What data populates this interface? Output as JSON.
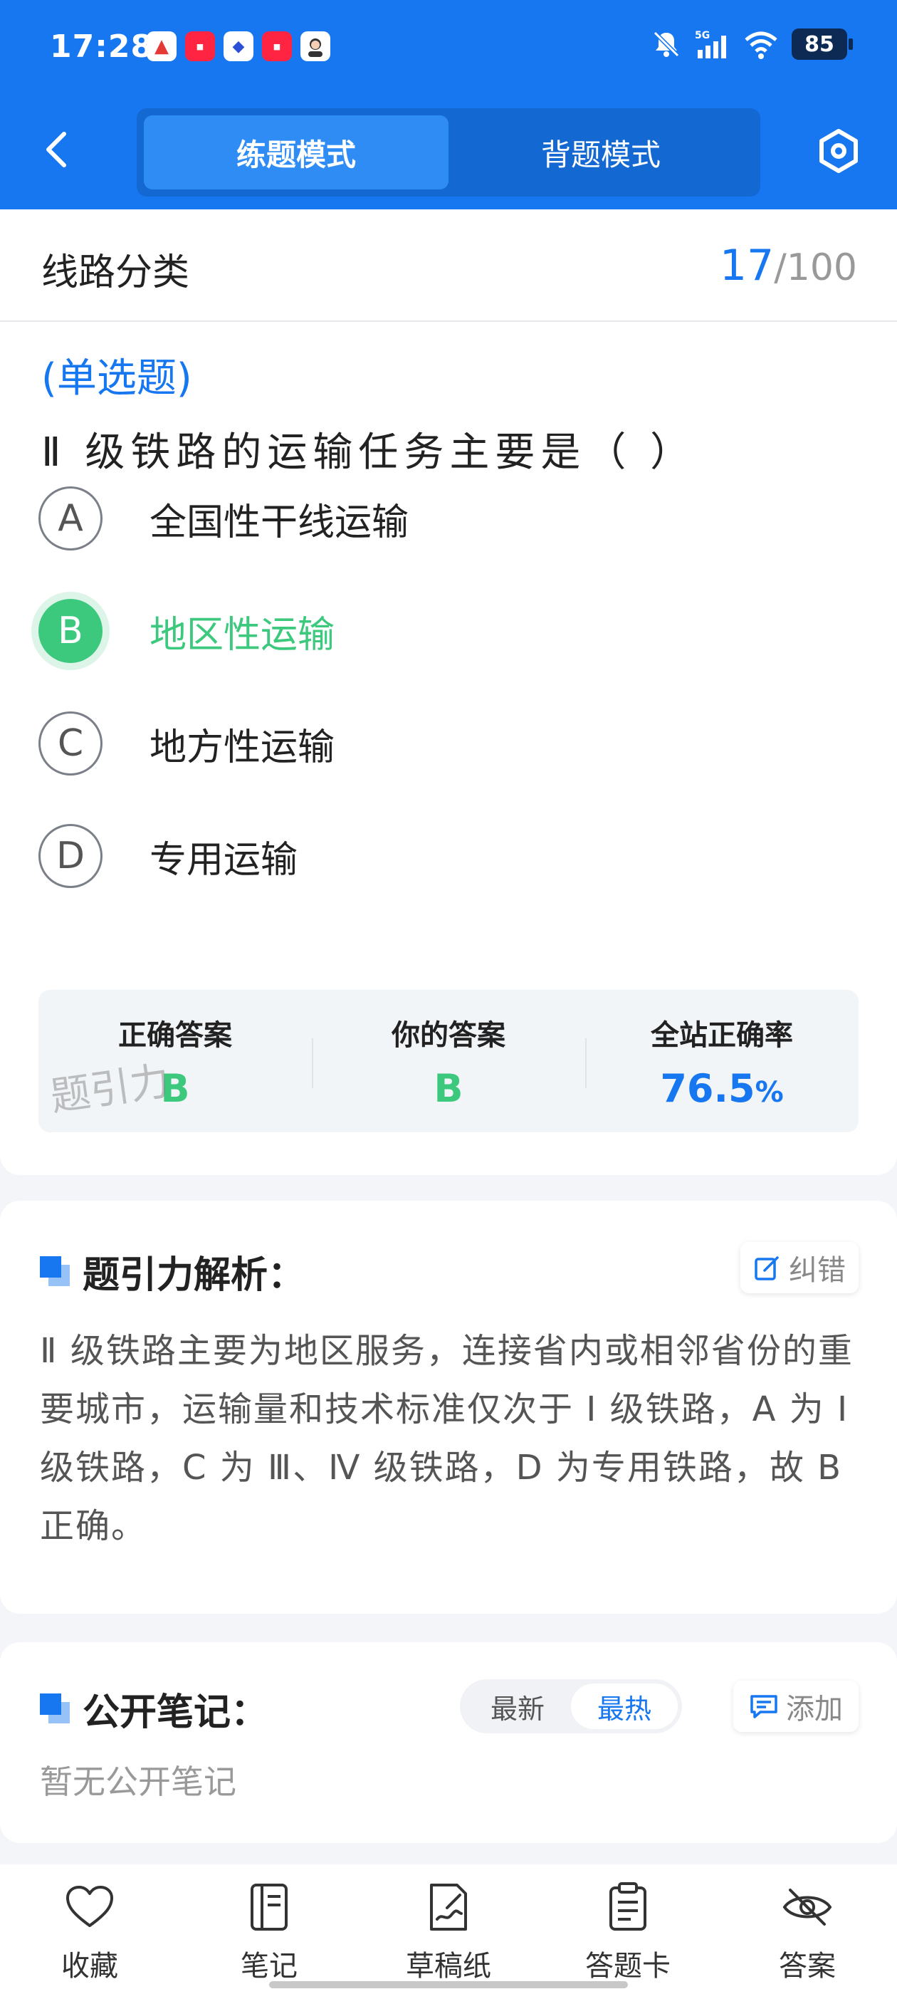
{
  "status_bar": {
    "time": "17:28",
    "battery": "85",
    "app_icons": [
      "app-a-icon",
      "xiaohongshu-icon",
      "shield-app-icon",
      "xiaohongshu-icon",
      "avatar-app-icon"
    ],
    "indicators": [
      "mute-icon",
      "5g-signal-icon",
      "wifi-icon"
    ]
  },
  "header": {
    "modes": [
      {
        "label": "练题模式",
        "active": true
      },
      {
        "label": "背题模式",
        "active": false
      }
    ],
    "back_icon": "chevron-left-icon",
    "settings_icon": "settings-hex-icon"
  },
  "question": {
    "category": "线路分类",
    "current": "17",
    "total": "/100",
    "type": "(单选题)",
    "text": "Ⅱ 级铁路的运输任务主要是（ ）",
    "options": [
      {
        "letter": "A",
        "text": "全国性干线运输",
        "selected": false
      },
      {
        "letter": "B",
        "text": "地区性运输",
        "selected": true
      },
      {
        "letter": "C",
        "text": "地方性运输",
        "selected": false
      },
      {
        "letter": "D",
        "text": "专用运输",
        "selected": false
      }
    ],
    "result": {
      "correct_label": "正确答案",
      "correct_value": "B",
      "yours_label": "你的答案",
      "yours_value": "B",
      "rate_label": "全站正确率",
      "rate_value": "76.5",
      "rate_unit": "%"
    },
    "watermark": "题引力"
  },
  "analysis": {
    "title": "题引力解析：",
    "report_label": "纠错",
    "text": "Ⅱ 级铁路主要为地区服务，连接省内或相邻省份的重要城市，运输量和技术标准仅次于 Ⅰ 级铁路，A 为 Ⅰ 级铁路，C 为 Ⅲ、Ⅳ 级铁路，D 为专用铁路，故 B 正确。"
  },
  "notes": {
    "title": "公开笔记：",
    "sort_options": [
      {
        "label": "最新",
        "active": false
      },
      {
        "label": "最热",
        "active": true
      }
    ],
    "add_label": "添加",
    "empty_text": "暂无公开笔记"
  },
  "bottom_nav": [
    {
      "label": "收藏",
      "icon": "heart-icon"
    },
    {
      "label": "笔记",
      "icon": "notebook-icon"
    },
    {
      "label": "草稿纸",
      "icon": "draft-paper-icon"
    },
    {
      "label": "答题卡",
      "icon": "answer-sheet-icon"
    },
    {
      "label": "答案",
      "icon": "eye-off-icon"
    }
  ],
  "colors": {
    "brand_blue": "#1677f0",
    "correct_green": "#3cc97e"
  }
}
